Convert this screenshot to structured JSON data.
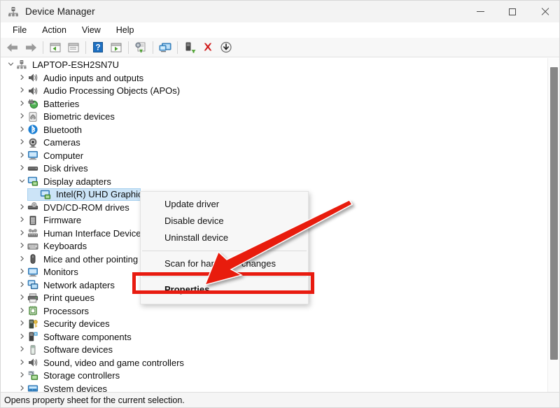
{
  "window": {
    "title": "Device Manager",
    "icon": "device-manager-icon",
    "controls": {
      "minimize": "minimize-icon",
      "maximize": "maximize-icon",
      "close": "close-icon"
    }
  },
  "menubar": {
    "items": [
      {
        "label": "File"
      },
      {
        "label": "Action"
      },
      {
        "label": "View"
      },
      {
        "label": "Help"
      }
    ]
  },
  "toolbar": {
    "buttons": [
      {
        "name": "back-arrow-icon"
      },
      {
        "name": "forward-arrow-icon"
      },
      {
        "name": "up-one-level-icon"
      },
      {
        "name": "show-hide-console-tree-icon"
      },
      {
        "name": "help-icon"
      },
      {
        "name": "properties-icon"
      },
      {
        "name": "update-driver-icon"
      },
      {
        "name": "scan-hardware-changes-icon"
      },
      {
        "name": "enable-device-icon"
      },
      {
        "name": "uninstall-device-icon"
      },
      {
        "name": "disable-device-icon"
      }
    ]
  },
  "tree": {
    "root": {
      "label": "LAPTOP-ESH2SN7U",
      "expanded": true,
      "icon": "computer-root-icon",
      "chevron": "chevron-down"
    },
    "nodes": [
      {
        "label": "Audio inputs and outputs",
        "icon": "speaker-icon",
        "chevron": "chevron-right",
        "expanded": false,
        "selected": false
      },
      {
        "label": "Audio Processing Objects (APOs)",
        "icon": "speaker-icon",
        "chevron": "chevron-right",
        "expanded": false,
        "selected": false
      },
      {
        "label": "Batteries",
        "icon": "battery-icon",
        "chevron": "chevron-right",
        "expanded": false,
        "selected": false
      },
      {
        "label": "Biometric devices",
        "icon": "fingerprint-icon",
        "chevron": "chevron-right",
        "expanded": false,
        "selected": false
      },
      {
        "label": "Bluetooth",
        "icon": "bluetooth-icon",
        "chevron": "chevron-right",
        "expanded": false,
        "selected": false
      },
      {
        "label": "Cameras",
        "icon": "camera-icon",
        "chevron": "chevron-right",
        "expanded": false,
        "selected": false
      },
      {
        "label": "Computer",
        "icon": "monitor-icon",
        "chevron": "chevron-right",
        "expanded": false,
        "selected": false
      },
      {
        "label": "Disk drives",
        "icon": "disk-drive-icon",
        "chevron": "chevron-right",
        "expanded": false,
        "selected": false
      },
      {
        "label": "Display adapters",
        "icon": "display-adapter-icon",
        "chevron": "chevron-down",
        "expanded": true,
        "selected": false
      },
      {
        "label": "Intel(R) UHD Graphics",
        "icon": "display-adapter-icon",
        "chevron": "",
        "expanded": false,
        "selected": true,
        "child": true
      },
      {
        "label": "DVD/CD-ROM drives",
        "icon": "optical-drive-icon",
        "chevron": "chevron-right",
        "expanded": false,
        "selected": false
      },
      {
        "label": "Firmware",
        "icon": "firmware-icon",
        "chevron": "chevron-right",
        "expanded": false,
        "selected": false
      },
      {
        "label": "Human Interface Devices",
        "icon": "hid-icon",
        "chevron": "chevron-right",
        "expanded": false,
        "selected": false
      },
      {
        "label": "Keyboards",
        "icon": "keyboard-icon",
        "chevron": "chevron-right",
        "expanded": false,
        "selected": false
      },
      {
        "label": "Mice and other pointing devices",
        "icon": "mouse-icon",
        "chevron": "chevron-right",
        "expanded": false,
        "selected": false
      },
      {
        "label": "Monitors",
        "icon": "monitor-icon",
        "chevron": "chevron-right",
        "expanded": false,
        "selected": false
      },
      {
        "label": "Network adapters",
        "icon": "network-adapter-icon",
        "chevron": "chevron-right",
        "expanded": false,
        "selected": false
      },
      {
        "label": "Print queues",
        "icon": "printer-icon",
        "chevron": "chevron-right",
        "expanded": false,
        "selected": false
      },
      {
        "label": "Processors",
        "icon": "processor-icon",
        "chevron": "chevron-right",
        "expanded": false,
        "selected": false
      },
      {
        "label": "Security devices",
        "icon": "security-device-icon",
        "chevron": "chevron-right",
        "expanded": false,
        "selected": false
      },
      {
        "label": "Software components",
        "icon": "software-component-icon",
        "chevron": "chevron-right",
        "expanded": false,
        "selected": false
      },
      {
        "label": "Software devices",
        "icon": "software-device-icon",
        "chevron": "chevron-right",
        "expanded": false,
        "selected": false
      },
      {
        "label": "Sound, video and game controllers",
        "icon": "speaker-icon",
        "chevron": "chevron-right",
        "expanded": false,
        "selected": false
      },
      {
        "label": "Storage controllers",
        "icon": "storage-controller-icon",
        "chevron": "chevron-right",
        "expanded": false,
        "selected": false
      },
      {
        "label": "System devices",
        "icon": "system-device-icon",
        "chevron": "chevron-right",
        "expanded": false,
        "selected": false
      }
    ]
  },
  "context_menu": {
    "items": [
      {
        "label": "Update driver",
        "bold": false,
        "separator_after": false
      },
      {
        "label": "Disable device",
        "bold": false,
        "separator_after": false
      },
      {
        "label": "Uninstall device",
        "bold": false,
        "separator_after": true
      },
      {
        "label": "Scan for hardware changes",
        "bold": false,
        "separator_after": true
      },
      {
        "label": "Properties",
        "bold": true,
        "separator_after": false
      }
    ]
  },
  "annotations": {
    "highlight_color": "#e81b10",
    "arrow_color": "#e81b10",
    "highlighted_item": "Properties"
  },
  "statusbar": {
    "text": "Opens property sheet for the current selection."
  },
  "colors": {
    "selection_fill": "#cce4f7",
    "selection_border": "#a9d1ef",
    "titlebar_bg": "#f3f3f3",
    "toolbar_bg": "#f7f7f7",
    "statusbar_bg": "#f5f5f5",
    "scrollbar_thumb": "#868686"
  }
}
